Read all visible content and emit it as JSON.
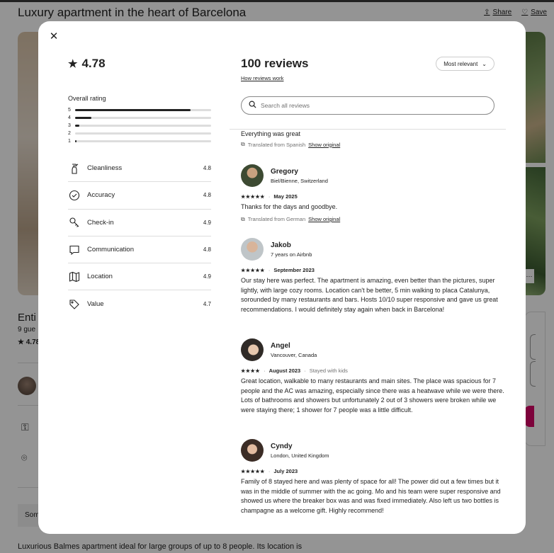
{
  "background": {
    "title": "Luxury apartment in the heart of Barcelona",
    "share_label": "Share",
    "save_label": "Save",
    "subtitle": "Enti",
    "guests": "9 gue",
    "rating": "★ 4.78",
    "some": "Som",
    "description": "Luxurious Balmes apartment ideal for large groups of up to 8 people. Its location is"
  },
  "modal": {
    "close_icon": "close-icon",
    "overall": {
      "rating": "4.78",
      "label": "Overall rating",
      "distribution": [
        {
          "stars": "5",
          "fraction": 0.85
        },
        {
          "stars": "4",
          "fraction": 0.12
        },
        {
          "stars": "3",
          "fraction": 0.03
        },
        {
          "stars": "2",
          "fraction": 0.0
        },
        {
          "stars": "1",
          "fraction": 0.01
        }
      ]
    },
    "categories": [
      {
        "label": "Cleanliness",
        "value": "4.8",
        "icon": "spray-bottle-icon"
      },
      {
        "label": "Accuracy",
        "value": "4.8",
        "icon": "check-circle-icon"
      },
      {
        "label": "Check-in",
        "value": "4.9",
        "icon": "key-icon"
      },
      {
        "label": "Communication",
        "value": "4.8",
        "icon": "chat-bubble-icon"
      },
      {
        "label": "Location",
        "value": "4.9",
        "icon": "map-icon"
      },
      {
        "label": "Value",
        "value": "4.7",
        "icon": "tag-icon"
      }
    ],
    "reviews_header": {
      "title": "100 reviews",
      "how_link": "How reviews work",
      "sort_label": "Most relevant",
      "search_placeholder": "Search all reviews"
    },
    "previous_review": {
      "text": "Everything was great",
      "translated": "Translated from Spanish",
      "show_original": "Show original"
    },
    "reviews": [
      {
        "name": "Gregory",
        "subtitle": "Biel/Bienne, Switzerland",
        "stars": "★★★★★",
        "date": "May 2025",
        "extra": "",
        "text": "Thanks for the days and goodbye.",
        "translated": "Translated from German",
        "show_original": "Show original"
      },
      {
        "name": "Jakob",
        "subtitle": "7 years on Airbnb",
        "stars": "★★★★★",
        "date": "September 2023",
        "extra": "",
        "text": "Our stay here was perfect. The apartment is amazing, even better than the pictures, super lightly, with large cozy rooms. Location can't be better, 5 min walking to placa Catalunya, sorounded by many restaurants and bars. Hosts 10/10 super responsive and gave us great recommendations. I would definitely stay again when back in Barcelona!"
      },
      {
        "name": "Angel",
        "subtitle": "Vancouver, Canada",
        "stars": "★★★★",
        "date": "August 2023",
        "extra": "Stayed with kids",
        "text": "Great location, walkable to many restaurants and main sites. The place was spacious for 7 people and the AC was amazing, especially since there was a heatwave while we were there. Lots of bathrooms and showers but unfortunately 2 out of 3 showers were broken while we were staying there; 1 shower for 7 people was a little difficult."
      },
      {
        "name": "Cyndy",
        "subtitle": "London, United Kingdom",
        "stars": "★★★★★",
        "date": "July 2023",
        "extra": "",
        "text": "Family of 8 stayed here and was plenty of space for all!  The power did out a few times but it was in the middle of summer with the ac going.  Mo and his team were super responsive and showed us where the breaker box was and was fixed immediately.  Also left us  two bottles is champagne as a welcome gift.  Highly recommend!"
      }
    ]
  }
}
